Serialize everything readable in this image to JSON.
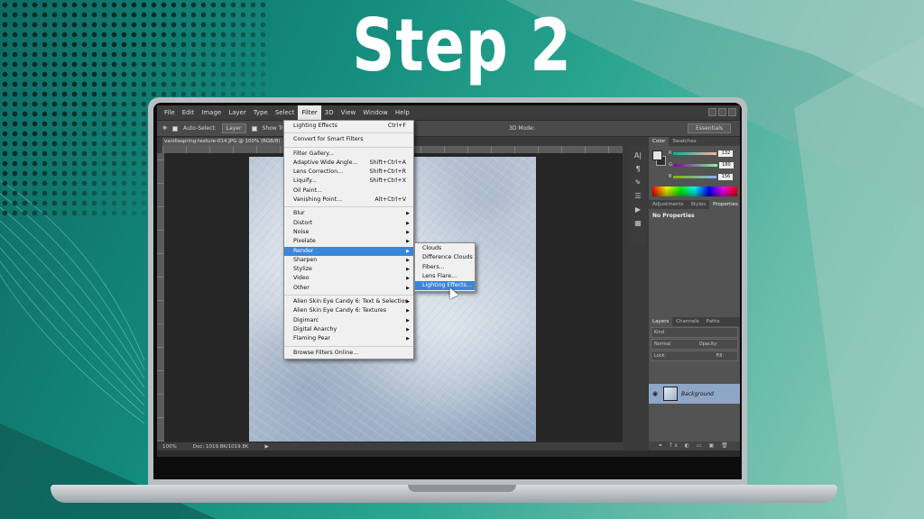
{
  "headline": "Step 2",
  "photoshop": {
    "menubar": [
      "File",
      "Edit",
      "Image",
      "Layer",
      "Type",
      "Select",
      "Filter",
      "3D",
      "View",
      "Window",
      "Help"
    ],
    "active_menu": "Filter",
    "options": {
      "auto_select": "Auto-Select:",
      "auto_select_value": "Layer",
      "show_transform": "Show Tran",
      "mode_3d": "3D Mode:",
      "workspace": "Essentials"
    },
    "doc_tab": "vanillaspring-texture-014.JPG @ 100% (RGB/8)",
    "status": {
      "zoom": "100%",
      "doc": "Doc: 1019.8K/1019.8K"
    },
    "filter_menu": [
      {
        "label": "Lighting Effects",
        "shortcut": "Ctrl+F"
      },
      {
        "sep": true
      },
      {
        "label": "Convert for Smart Filters"
      },
      {
        "sep": true
      },
      {
        "label": "Filter Gallery..."
      },
      {
        "label": "Adaptive Wide Angle...",
        "shortcut": "Shift+Ctrl+A"
      },
      {
        "label": "Lens Correction...",
        "shortcut": "Shift+Ctrl+R"
      },
      {
        "label": "Liquify...",
        "shortcut": "Shift+Ctrl+X"
      },
      {
        "label": "Oil Paint..."
      },
      {
        "label": "Vanishing Point...",
        "shortcut": "Alt+Ctrl+V"
      },
      {
        "sep": true
      },
      {
        "label": "Blur",
        "sub": true
      },
      {
        "label": "Distort",
        "sub": true
      },
      {
        "label": "Noise",
        "sub": true
      },
      {
        "label": "Pixelate",
        "sub": true
      },
      {
        "label": "Render",
        "sub": true,
        "highlight": true
      },
      {
        "label": "Sharpen",
        "sub": true
      },
      {
        "label": "Stylize",
        "sub": true
      },
      {
        "label": "Video",
        "sub": true
      },
      {
        "label": "Other",
        "sub": true
      },
      {
        "sep": true
      },
      {
        "label": "Alien Skin Eye Candy 6: Text & Selection",
        "sub": true
      },
      {
        "label": "Alien Skin Eye Candy 6: Textures",
        "sub": true
      },
      {
        "label": "Digimarc",
        "sub": true
      },
      {
        "label": "Digital Anarchy",
        "sub": true
      },
      {
        "label": "Flaming Pear",
        "sub": true
      },
      {
        "sep": true
      },
      {
        "label": "Browse Filters Online..."
      }
    ],
    "render_submenu": [
      {
        "label": "Clouds"
      },
      {
        "label": "Difference Clouds"
      },
      {
        "label": "Fibers..."
      },
      {
        "label": "Lens Flare..."
      },
      {
        "label": "Lighting Effects...",
        "highlight": true
      }
    ],
    "color_panel": {
      "tabs": [
        "Color",
        "Swatches"
      ],
      "channels": [
        {
          "name": "R",
          "value": "132"
        },
        {
          "name": "G",
          "value": "180"
        },
        {
          "name": "B",
          "value": "156"
        }
      ]
    },
    "props_panel": {
      "tabs": [
        "Adjustments",
        "Styles",
        "Properties"
      ],
      "body": "No Properties"
    },
    "layers_panel": {
      "tabs": [
        "Layers",
        "Channels",
        "Paths"
      ],
      "kind": "Kind",
      "blend": "Normal",
      "opacity": "Opacity:",
      "lock": "Lock:",
      "fill": "Fill:",
      "layer_name": "Background"
    },
    "colors": {
      "ui_dark": "#3a3a3a",
      "highlight": "#3b86d9",
      "menu_bg": "#f0f0f0"
    }
  }
}
